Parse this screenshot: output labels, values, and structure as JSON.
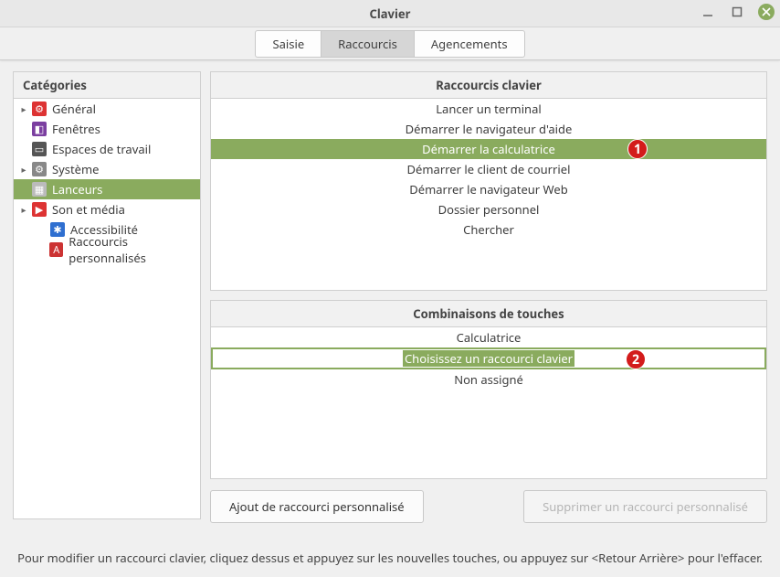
{
  "window": {
    "title": "Clavier"
  },
  "tabs": [
    {
      "label": "Saisie",
      "active": false
    },
    {
      "label": "Raccourcis",
      "active": true
    },
    {
      "label": "Agencements",
      "active": false
    }
  ],
  "sidebar": {
    "header": "Catégories",
    "items": [
      {
        "label": "Général",
        "hasChildren": true,
        "selected": false,
        "iconColor": "#d33",
        "glyph": "⚙"
      },
      {
        "label": "Fenêtres",
        "hasChildren": false,
        "selected": false,
        "iconColor": "#7b3fa0",
        "glyph": "◧"
      },
      {
        "label": "Espaces de travail",
        "hasChildren": false,
        "selected": false,
        "iconColor": "#555",
        "glyph": "▭"
      },
      {
        "label": "Système",
        "hasChildren": true,
        "selected": false,
        "iconColor": "#888",
        "glyph": "⚙"
      },
      {
        "label": "Lanceurs",
        "hasChildren": false,
        "selected": true,
        "iconColor": "#bbb",
        "glyph": "▦"
      },
      {
        "label": "Son et média",
        "hasChildren": true,
        "selected": false,
        "iconColor": "#d33",
        "glyph": "▶"
      },
      {
        "label": "Accessibilité",
        "hasChildren": false,
        "selected": false,
        "indent": true,
        "iconColor": "#2f6fd0",
        "glyph": "✱"
      },
      {
        "label": "Raccourcis personnalisés",
        "hasChildren": false,
        "selected": false,
        "indent": true,
        "iconColor": "#c33",
        "glyph": "A"
      }
    ]
  },
  "shortcuts": {
    "header": "Raccourcis clavier",
    "rows": [
      {
        "label": "Lancer un terminal",
        "selected": false
      },
      {
        "label": "Démarrer le navigateur d'aide",
        "selected": false
      },
      {
        "label": "Démarrer la calculatrice",
        "selected": true,
        "badge": "1"
      },
      {
        "label": "Démarrer le client de courriel",
        "selected": false
      },
      {
        "label": "Démarrer le navigateur Web",
        "selected": false
      },
      {
        "label": "Dossier personnel",
        "selected": false
      },
      {
        "label": "Chercher",
        "selected": false
      }
    ]
  },
  "bindings": {
    "header": "Combinaisons de touches",
    "rows": [
      {
        "label": "Calculatrice",
        "mode": "plain"
      },
      {
        "label": "Choisissez un raccourci clavier",
        "mode": "editing",
        "badge": "2"
      },
      {
        "label": "Non assigné",
        "mode": "plain"
      }
    ]
  },
  "buttons": {
    "add": "Ajout de raccourci personnalisé",
    "remove": "Supprimer un raccourci personnalisé"
  },
  "hint": "Pour modifier un raccourci clavier, cliquez dessus et appuyez sur les nouvelles touches, ou appuyez sur <Retour Arrière> pour l'effacer."
}
